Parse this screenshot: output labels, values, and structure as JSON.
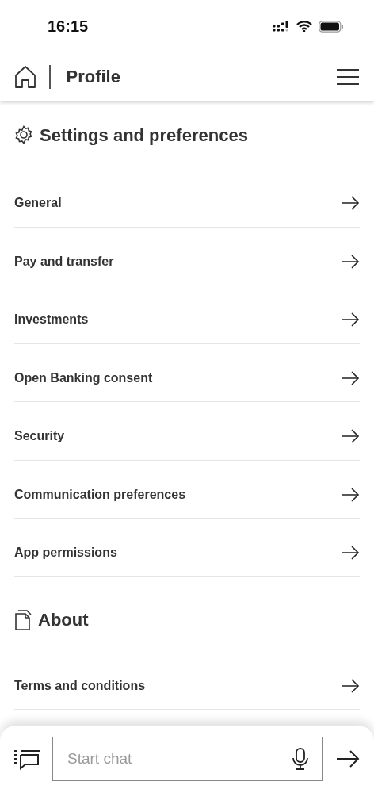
{
  "status_bar": {
    "time": "16:15"
  },
  "header": {
    "title": "Profile"
  },
  "sections": [
    {
      "title": "Settings and preferences",
      "kind": "gear",
      "items": [
        {
          "label": "General"
        },
        {
          "label": "Pay and transfer"
        },
        {
          "label": "Investments"
        },
        {
          "label": "Open Banking consent"
        },
        {
          "label": "Security"
        },
        {
          "label": "Communication preferences"
        },
        {
          "label": "App permissions"
        }
      ]
    },
    {
      "title": "About",
      "kind": "document",
      "items": [
        {
          "label": "Terms and conditions"
        }
      ]
    }
  ],
  "chat": {
    "placeholder": "Start chat"
  }
}
